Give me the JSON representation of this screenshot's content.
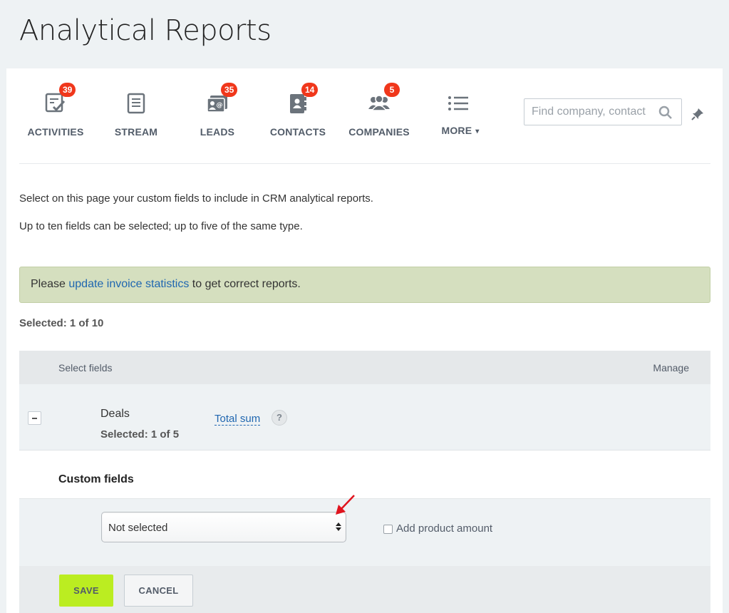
{
  "page": {
    "title": "Analytical Reports"
  },
  "toolbar": {
    "items": [
      {
        "label": "ACTIVITIES",
        "badge": "39",
        "icon": "activities-checklist-icon"
      },
      {
        "label": "STREAM",
        "badge": "",
        "icon": "stream-document-icon"
      },
      {
        "label": "LEADS",
        "badge": "35",
        "icon": "leads-contact-card-icon"
      },
      {
        "label": "CONTACTS",
        "badge": "14",
        "icon": "contacts-address-book-icon"
      },
      {
        "label": "COMPANIES",
        "badge": "5",
        "icon": "companies-people-icon"
      },
      {
        "label": "MORE",
        "badge": "",
        "icon": "more-list-icon"
      }
    ],
    "search": {
      "placeholder": "Find company, contact",
      "icon": "search-icon"
    },
    "pin_icon": "pin-icon",
    "badge_color": "#f0371b"
  },
  "intro": {
    "line1": "Select on this page your custom fields to include in CRM analytical reports.",
    "line2": "Up to ten fields can be selected; up to five of the same type."
  },
  "alert": {
    "prefix": "Please ",
    "link": "update invoice statistics",
    "suffix": " to get correct reports.",
    "background": "#d5dfbf"
  },
  "selected_total": "Selected: 1 of 10",
  "table": {
    "header_left": "Select fields",
    "header_right": "Manage",
    "group": {
      "name": "Deals",
      "selected": "Selected: 1 of 5",
      "field_link": "Total sum",
      "help": "?"
    }
  },
  "custom_fields": {
    "title": "Custom fields",
    "select_value": "Not selected",
    "checkbox_label": "Add product amount",
    "checkbox_checked": false
  },
  "buttons": {
    "save": "SAVE",
    "cancel": "CANCEL",
    "save_color": "#bbed21"
  }
}
